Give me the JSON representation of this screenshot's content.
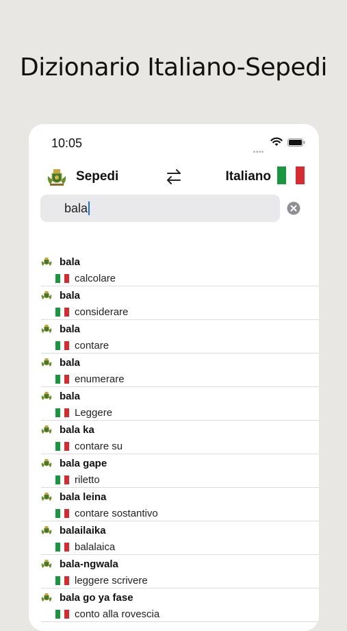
{
  "headline": "Dizionario Italiano-Sepedi",
  "status": {
    "time": "10:05"
  },
  "languages": {
    "source": "Sepedi",
    "target": "Italiano"
  },
  "search": {
    "value": "bala"
  },
  "results": [
    {
      "term": "bala",
      "translation": "calcolare"
    },
    {
      "term": "bala",
      "translation": "considerare"
    },
    {
      "term": "bala",
      "translation": "contare"
    },
    {
      "term": "bala",
      "translation": "enumerare"
    },
    {
      "term": "bala",
      "translation": "Leggere"
    },
    {
      "term": "bala ka",
      "translation": "contare su"
    },
    {
      "term": "bala gape",
      "translation": "riletto"
    },
    {
      "term": "bala leina",
      "translation": "contare sostantivo"
    },
    {
      "term": "balailaika",
      "translation": "balalaica"
    },
    {
      "term": "bala-ngwala",
      "translation": "leggere scrivere"
    },
    {
      "term": "bala go ya fase",
      "translation": "conto alla rovescia"
    }
  ],
  "colors": {
    "background": "#e9e7e3",
    "italy_green": "#1a9640",
    "italy_red": "#d62b2f",
    "caret": "#1a6fe8"
  },
  "icons": {
    "swap": "swap-arrows-icon",
    "clear": "clear-search-icon",
    "source_flag": "limpopo-crest-icon",
    "target_flag": "italy-flag-icon"
  }
}
